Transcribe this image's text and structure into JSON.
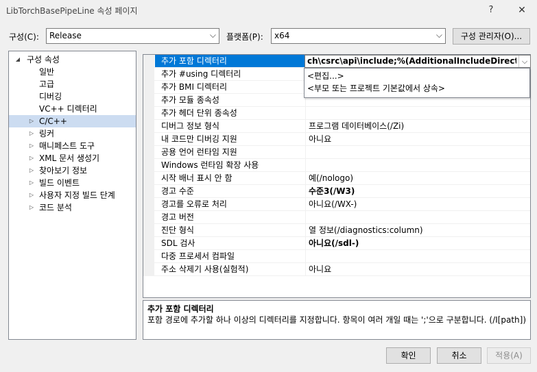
{
  "window": {
    "title": "LibTorchBasePipeLine 속성 페이지",
    "help_label": "?",
    "close_label": "✕"
  },
  "config": {
    "label": "구성(C):",
    "value": "Release"
  },
  "platform": {
    "label": "플랫폼(P):",
    "value": "x64"
  },
  "config_manager_label": "구성 관리자(O)...",
  "tree": {
    "root": "구성 속성",
    "items": [
      {
        "label": "일반",
        "expander": ""
      },
      {
        "label": "고급",
        "expander": ""
      },
      {
        "label": "디버깅",
        "expander": ""
      },
      {
        "label": "VC++ 디렉터리",
        "expander": ""
      },
      {
        "label": "C/C++",
        "expander": "▷",
        "selected": true
      },
      {
        "label": "링커",
        "expander": "▷"
      },
      {
        "label": "매니페스트 도구",
        "expander": "▷"
      },
      {
        "label": "XML 문서 생성기",
        "expander": "▷"
      },
      {
        "label": "찾아보기 정보",
        "expander": "▷"
      },
      {
        "label": "빌드 이벤트",
        "expander": "▷"
      },
      {
        "label": "사용자 지정 빌드 단계",
        "expander": "▷"
      },
      {
        "label": "코드 분석",
        "expander": "▷"
      }
    ]
  },
  "grid": {
    "rows": [
      {
        "name": "추가 포함 디렉터리",
        "value": "",
        "selected": true
      },
      {
        "name": "추가 #using 디렉터리",
        "value": ""
      },
      {
        "name": "추가 BMI 디렉터리",
        "value": ""
      },
      {
        "name": "추가 모듈 종속성",
        "value": ""
      },
      {
        "name": "추가 헤더 단위 종속성",
        "value": ""
      },
      {
        "name": "디버그 정보 형식",
        "value": "프로그램 데이터베이스(/Zi)"
      },
      {
        "name": "내 코드만 디버깅 지원",
        "value": "아니요"
      },
      {
        "name": "공용 언어 런타임 지원",
        "value": ""
      },
      {
        "name": "Windows 런타임 확장 사용",
        "value": ""
      },
      {
        "name": "시작 배너 표시 안 함",
        "value": "예(/nologo)"
      },
      {
        "name": "경고 수준",
        "value": "수준3(/W3)",
        "bold": true
      },
      {
        "name": "경고를 오류로 처리",
        "value": "아니요(/WX-)"
      },
      {
        "name": "경고 버전",
        "value": ""
      },
      {
        "name": "진단 형식",
        "value": "열 정보(/diagnostics:column)"
      },
      {
        "name": "SDL 검사",
        "value": "아니요(/sdl-)",
        "bold": true
      },
      {
        "name": "다중 프로세서 컴파일",
        "value": ""
      },
      {
        "name": "주소 삭제기 사용(실험적)",
        "value": "아니요"
      }
    ],
    "edit_value": "ch\\csrc\\api\\include;%(AdditionalIncludeDirectories)",
    "dropdown_options": [
      "<편집...>",
      "<부모 또는 프로젝트 기본값에서 상속>"
    ]
  },
  "description": {
    "title": "추가 포함 디렉터리",
    "text": "포함 경로에 추가할 하나 이상의 디렉터리를 지정합니다. 항목이 여러 개일 때는 ';'으로 구분합니다. (/I[path])"
  },
  "buttons": {
    "ok": "확인",
    "cancel": "취소",
    "apply": "적용(A)"
  },
  "colors": {
    "selection": "#0078d7",
    "tree_selection": "#ccdcf1"
  }
}
